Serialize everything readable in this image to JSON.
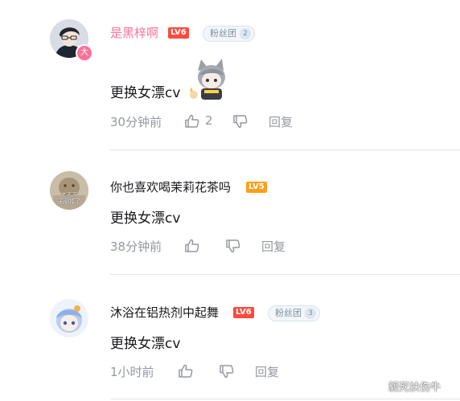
{
  "colors": {
    "vip_name": "#fb7299",
    "lv6": "#ff4a3d",
    "lv5": "#ff9f1a",
    "meta": "#9499a0"
  },
  "comments": [
    {
      "username": "是黑梓啊",
      "level": "LV6",
      "fan_badge": "粉丝团",
      "fan_level": "2",
      "avatar_badge": "大",
      "text": "更换女漂cv",
      "time": "30分钟前",
      "likes": "2",
      "reply": "回复"
    },
    {
      "username": "你也喜欢喝茉莉花茶吗",
      "level": "LV5",
      "avatar_caption_1": "才不不",
      "avatar_caption_2": "无聊捧了",
      "text": "更换女漂cv",
      "time": "38分钟前",
      "reply": "回复"
    },
    {
      "username": "沐浴在铝热剂中起舞",
      "level": "LV6",
      "fan_badge": "粉丝团",
      "fan_level": "3",
      "text": "更换女漂cv",
      "time": "1小时前",
      "reply": "回复"
    }
  ],
  "watermark": "毅死扶伤牛",
  "icons": [
    "like-icon",
    "dislike-icon",
    "sticker-cat-girl"
  ]
}
